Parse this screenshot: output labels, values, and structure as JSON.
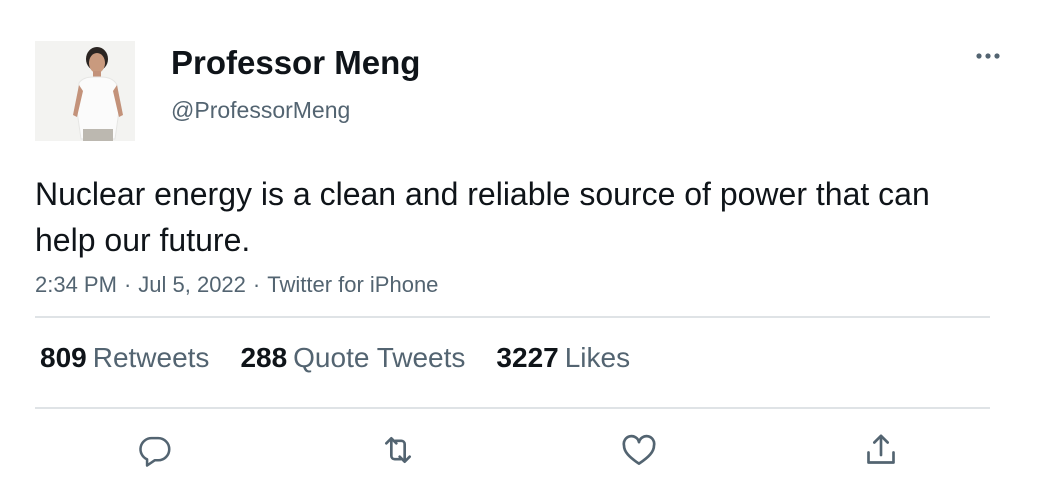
{
  "author": {
    "display_name": "Professor Meng",
    "handle": "@ProfessorMeng"
  },
  "tweet": {
    "text": "Nuclear energy is a clean and reliable source of power that can help our future.",
    "time": "2:34 PM",
    "date": "Jul 5, 2022",
    "source": "Twitter for iPhone",
    "separator": "·"
  },
  "stats": {
    "retweets": {
      "count": "809",
      "label": "Retweets"
    },
    "quote_tweets": {
      "count": "288",
      "label": "Quote Tweets"
    },
    "likes": {
      "count": "3227",
      "label": "Likes"
    }
  },
  "icons": {
    "more": "more-horizontal-icon",
    "reply": "reply-icon",
    "retweet": "retweet-icon",
    "like": "heart-icon",
    "share": "share-icon"
  },
  "colors": {
    "text_primary": "#0f1419",
    "text_secondary": "#536471",
    "divider": "#dfe3e6",
    "icon": "#536471"
  }
}
